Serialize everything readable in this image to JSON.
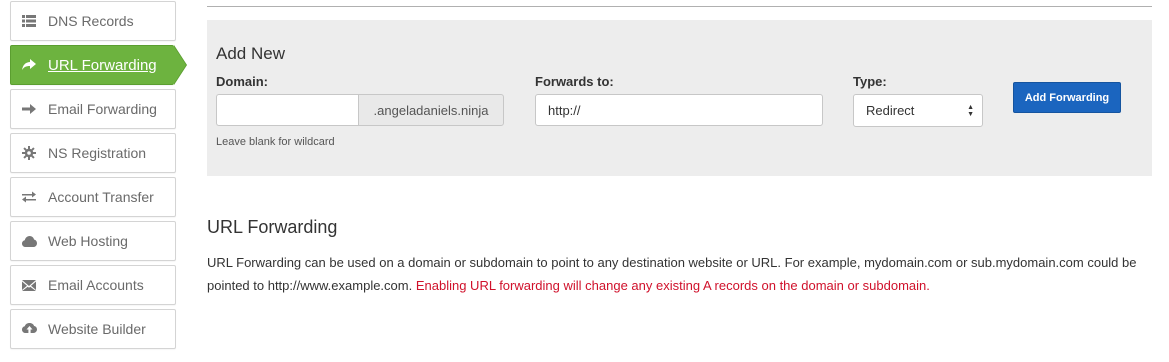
{
  "sidebar": {
    "items": [
      {
        "label": "DNS Records",
        "icon": "list-icon"
      },
      {
        "label": "URL Forwarding",
        "icon": "share-arrow-icon",
        "active": true
      },
      {
        "label": "Email Forwarding",
        "icon": "arrow-right-icon"
      },
      {
        "label": "NS Registration",
        "icon": "gear-icon"
      },
      {
        "label": "Account Transfer",
        "icon": "transfer-icon"
      },
      {
        "label": "Web Hosting",
        "icon": "cloud-icon"
      },
      {
        "label": "Email Accounts",
        "icon": "envelope-icon"
      },
      {
        "label": "Website Builder",
        "icon": "cloud-upload-icon"
      }
    ],
    "active_color": "#6db33f"
  },
  "form": {
    "title": "Add New",
    "domain": {
      "label": "Domain:",
      "value": "",
      "suffix": ".angeladaniels.ninja",
      "hint": "Leave blank for wildcard"
    },
    "forwards_to": {
      "label": "Forwards to:",
      "value": "http://"
    },
    "type": {
      "label": "Type:",
      "selected": "Redirect"
    },
    "submit_label": "Add Forwarding",
    "button_color": "#1b65bf"
  },
  "info": {
    "title": "URL Forwarding",
    "text": "URL Forwarding can be used on a domain or subdomain to point to any destination website or URL. For example, mydomain.com or sub.mydomain.com could be pointed to http://www.example.com.",
    "warning": "Enabling URL forwarding will change any existing A records on the domain or subdomain.",
    "warning_color": "#d0112b"
  }
}
